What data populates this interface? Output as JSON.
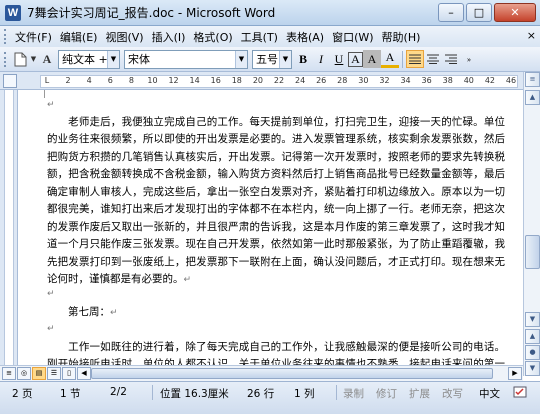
{
  "window": {
    "title": "7舞会计实习周记_报告.doc - Microsoft Word",
    "minimize_glyph": "–",
    "maximize_glyph": "□",
    "close_glyph": "✕"
  },
  "menu": {
    "items": [
      "文件(F)",
      "编辑(E)",
      "视图(V)",
      "插入(I)",
      "格式(O)",
      "工具(T)",
      "表格(A)",
      "窗口(W)",
      "帮助(H)"
    ],
    "help_prompt": "键入需要帮助的问题",
    "close_doc_glyph": "×"
  },
  "toolbar": {
    "style_value": "纯文本 + (̀",
    "font_value": "宋体",
    "size_value": "五号",
    "bold": "B",
    "italic": "I",
    "underline": "U",
    "char_border": "A",
    "char_shading": "A",
    "highlight": "A"
  },
  "ruler": {
    "ticks": [
      "L",
      "2",
      "4",
      "6",
      "8",
      "10",
      "12",
      "14",
      "16",
      "18",
      "20",
      "22",
      "24",
      "26",
      "28",
      "30",
      "32",
      "34",
      "36",
      "38",
      "40",
      "42",
      "46"
    ]
  },
  "document": {
    "paragraphs": [
      "老师走后，我便独立完成自己的工作。每天提前到单位，打扫完卫生，迎接一天的忙碌。单位的业务往来很频繁，所以即使的开出发票是必要的。进入发票管理系统，核实剩余发票张数，然后把购货方积攒的几笔销售认真核实后，开出发票。记得第一次开发票时，按照老师的要求先转换税额，把含税金额转换成不含税金额，输入购货方资料然后打上销售商品批号已经数量金额等，最后确定审制人审核人，完成这些后，拿出一张空白发票对齐，紧贴着打印机边缘放入。原本以为一切都很完美，谁知打出来后才发现打出的字体都不在本栏内，统一向上挪了一行。老师无奈，把这次的发票作废后又取出一张新的，并且很严肃的告诉我，这是本月作废的第三章发票了，这时我才知道一个月只能作废三张发票。现在自己开发票，依然如第一此时那般紧张，为了防止重蹈覆辙，我先把发票打印到一张废纸上，把发票那下一联附在上面，确认没问题后，才正式打印。现在想来无论何时，谨慎都是有必要的。",
      "第七周：",
      "工作一如既往的进行着，除了每天完成自己的工作外，让我感触最深的便是接听公司的电话。刚开始接听电话时，单位的人都不认识，关于单位业务往来的事情也不熟悉，接起电话来问的第一句便是：你好，你找哪位?第二句是对着财务处的人员说：那位是 XXX 啊，有人找。还好经过时间的磨练，再接电话时已经没那么发怵了，但还是重复重复再重复的说：喂，"
    ],
    "para_mark": "↵"
  },
  "status": {
    "page": "2 页",
    "section": "1 节",
    "page_of": "2/2",
    "position": "位置 16.3厘米",
    "line": "26 行",
    "col": "1 列",
    "rec": "录制",
    "trk": "修订",
    "ext": "扩展",
    "ovr": "改写",
    "lang": "中文"
  }
}
